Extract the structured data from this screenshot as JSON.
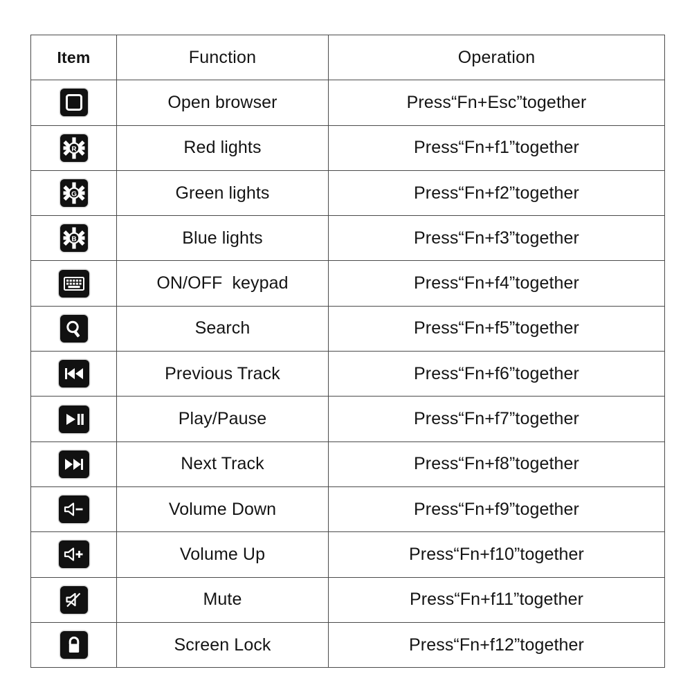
{
  "table": {
    "headers": {
      "item": "Item",
      "function": "Function",
      "operation": "Operation"
    },
    "rows": [
      {
        "icon": "browser-square-icon",
        "function": "Open browser",
        "operation": "Press“Fn+Esc”together"
      },
      {
        "icon": "red-light-icon",
        "function": "Red lights",
        "operation": "Press“Fn+f1”together"
      },
      {
        "icon": "green-light-icon",
        "function": "Green lights",
        "operation": "Press“Fn+f2”together"
      },
      {
        "icon": "blue-light-icon",
        "function": "Blue lights",
        "operation": "Press“Fn+f3”together"
      },
      {
        "icon": "keypad-icon",
        "function": "ON/OFF  keypad",
        "operation": "Press“Fn+f4”together"
      },
      {
        "icon": "search-icon",
        "function": "Search",
        "operation": "Press“Fn+f5”together"
      },
      {
        "icon": "previous-track-icon",
        "function": "Previous Track",
        "operation": "Press“Fn+f6”together"
      },
      {
        "icon": "play-pause-icon",
        "function": "Play/Pause",
        "operation": "Press“Fn+f7”together"
      },
      {
        "icon": "next-track-icon",
        "function": "Next Track",
        "operation": "Press“Fn+f8”together"
      },
      {
        "icon": "volume-down-icon",
        "function": "Volume Down",
        "operation": "Press“Fn+f9”together"
      },
      {
        "icon": "volume-up-icon",
        "function": "Volume Up",
        "operation": "Press“Fn+f10”together"
      },
      {
        "icon": "mute-icon",
        "function": "Mute",
        "operation": "Press“Fn+f11”together"
      },
      {
        "icon": "screen-lock-icon",
        "function": "Screen Lock",
        "operation": "Press“Fn+f12”together"
      }
    ],
    "light_letters": {
      "red": "R",
      "green": "G",
      "blue": "B"
    },
    "colors": {
      "border": "#4a4a4a",
      "text": "#141414",
      "keycap_background": "#111111",
      "keycap_glyph": "#ffffff",
      "page_background": "#ffffff"
    }
  }
}
